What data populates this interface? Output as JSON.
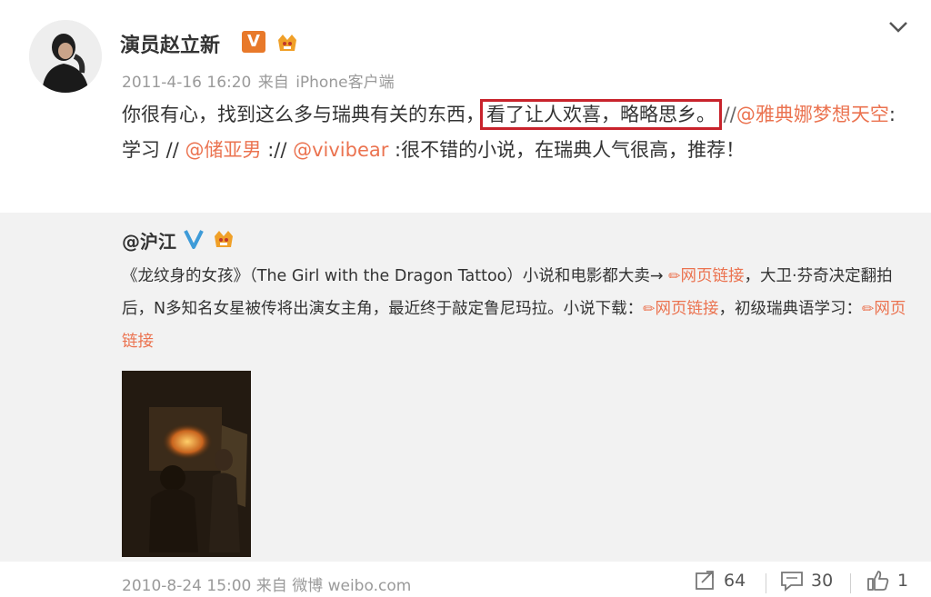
{
  "author": {
    "name": "演员赵立新",
    "verified_badge": "V"
  },
  "meta": {
    "timestamp": "2011-4-16 16:20",
    "source_prefix": "来自",
    "source": "iPhone客户端"
  },
  "post": {
    "part1": "你很有心，找到这么多与瑞典有关的东西，",
    "highlighted": "看了让人欢喜，略略思乡。",
    "sep1": " //",
    "mention1": "@雅典娜梦想天空",
    "text1": ":学习 // ",
    "mention2": "@储亚男",
    "text2": " :// ",
    "mention3": "@vivibear",
    "text3": " :很不错的小说，在瑞典人气很高，推荐！"
  },
  "repost": {
    "user": "@沪江",
    "t1": "《龙纹身的女孩》（The Girl with the Dragon Tattoo）小说和电影都大卖→ ",
    "link1": "网页链接",
    "t2": "，大卫·芬奇决定翻拍后，N多知名女星被传将出演女主角，最近终于敲定鲁尼玛拉。小说下载：",
    "link2": "网页链接",
    "t3": "，初级瑞典语学习：",
    "link3": "网页链接",
    "timestamp": "2010-8-24 15:00",
    "source_prefix": "来自",
    "source": "微博 weibo.com"
  },
  "actions": {
    "repost_count": "64",
    "comment_count": "30",
    "like_count": "1"
  },
  "colors": {
    "mention": "#eb7350",
    "highlight_box": "#c8232c",
    "verified_orange": "#e8792a",
    "verified_blue": "#3e9bd8"
  }
}
